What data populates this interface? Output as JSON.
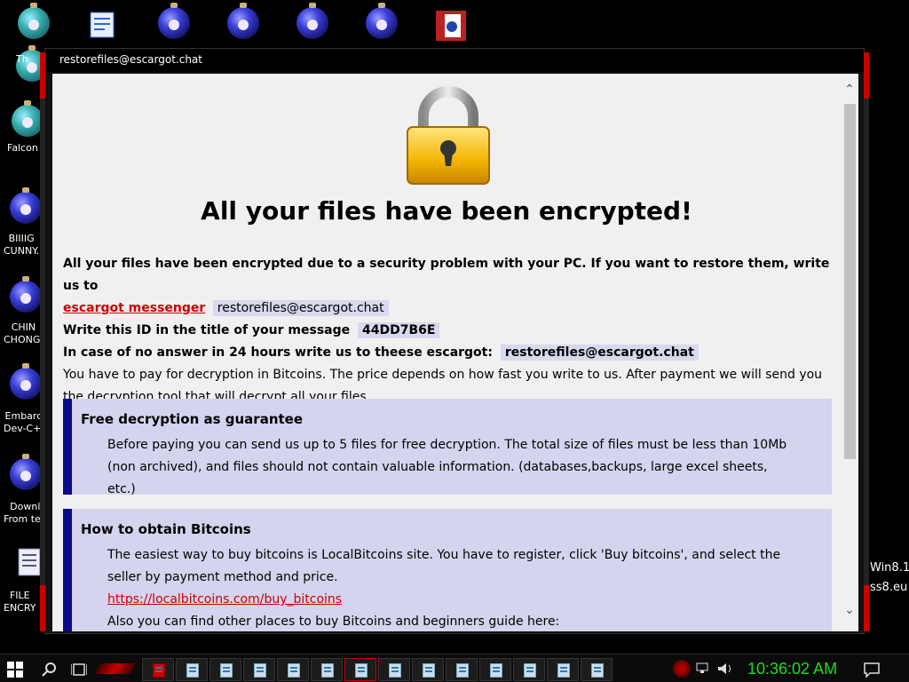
{
  "desktop": {
    "icons": [
      {
        "label": "Th",
        "name": "desktop-icon-th"
      },
      {
        "label": "Falcon",
        "name": "desktop-icon-falcon"
      },
      {
        "label": "BIIIIG\nCUNNY.",
        "name": "desktop-icon-biiiig"
      },
      {
        "label": "CHIN\nCHONG.",
        "name": "desktop-icon-chin-chong"
      },
      {
        "label": "Embarca\nDev-C++",
        "name": "desktop-icon-embarcadero"
      },
      {
        "label": "Downl\nFrom tea",
        "name": "desktop-icon-download"
      },
      {
        "label": "FILE\nENCRY",
        "name": "desktop-icon-file-encrypt"
      }
    ],
    "watermark_line1": "Win8.1",
    "watermark_line2": "ss8.eu"
  },
  "window": {
    "title": "restorefiles@escargot.chat"
  },
  "note": {
    "heading": "All your files have been encrypted!",
    "intro": "All your files have been encrypted due to a security problem with your PC. If you want to restore them, write us to",
    "messenger_link": "escargot messenger",
    "email": "restorefiles@escargot.chat",
    "id_prompt": "Write this ID in the title of your message",
    "id_value": "44DD7B6E",
    "no_answer_prompt": "In case of no answer in 24 hours write us to theese escargot:",
    "email_alt": "restorefiles@escargot.chat",
    "pay_text": "You have to pay for decryption in Bitcoins. The price depends on how fast you write to us. After payment we will send you the decryption tool that will decrypt all your files.",
    "free_title": "Free decryption as guarantee",
    "free_text": "Before paying you can send us up to 5 files for free decryption. The total size of files must be less than 10Mb (non archived), and files should not contain valuable information. (databases,backups, large excel sheets, etc.)",
    "obtain_title": "How to obtain Bitcoins",
    "obtain_text": "The easiest way to buy bitcoins is LocalBitcoins site. You have to register, click 'Buy bitcoins', and select the seller by payment method and price.",
    "obtain_link": "https://localbitcoins.com/buy_bitcoins",
    "obtain_more": "Also you can find other places to buy Bitcoins and beginners guide here:"
  },
  "taskbar": {
    "clock": "10:36:02 AM",
    "task_button_count": 14
  }
}
